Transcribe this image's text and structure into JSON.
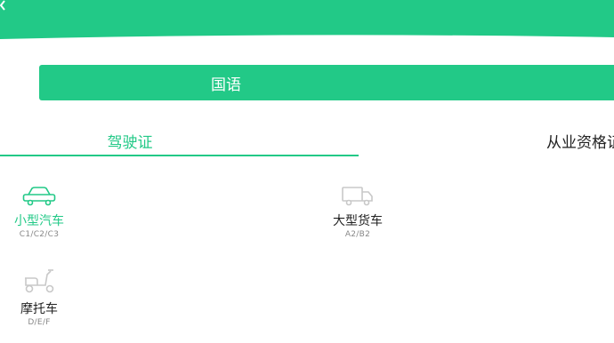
{
  "colors": {
    "accent": "#22c987",
    "inactive_icon": "#c8c8c8",
    "text_dark": "#222222",
    "text_muted": "#888888"
  },
  "language_button": {
    "label": "国语"
  },
  "tabs": [
    {
      "label": "驾驶证",
      "active": true
    },
    {
      "label": "从业资格证",
      "active": false
    }
  ],
  "vehicles": [
    {
      "icon": "car-icon",
      "name": "小型汽车",
      "code": "C1/C2/C3",
      "selected": true
    },
    {
      "icon": "truck-icon",
      "name": "大型货车",
      "code": "A2/B2",
      "selected": false
    },
    {
      "icon": "scooter-icon",
      "name": "摩托车",
      "code": "D/E/F",
      "selected": false
    }
  ]
}
